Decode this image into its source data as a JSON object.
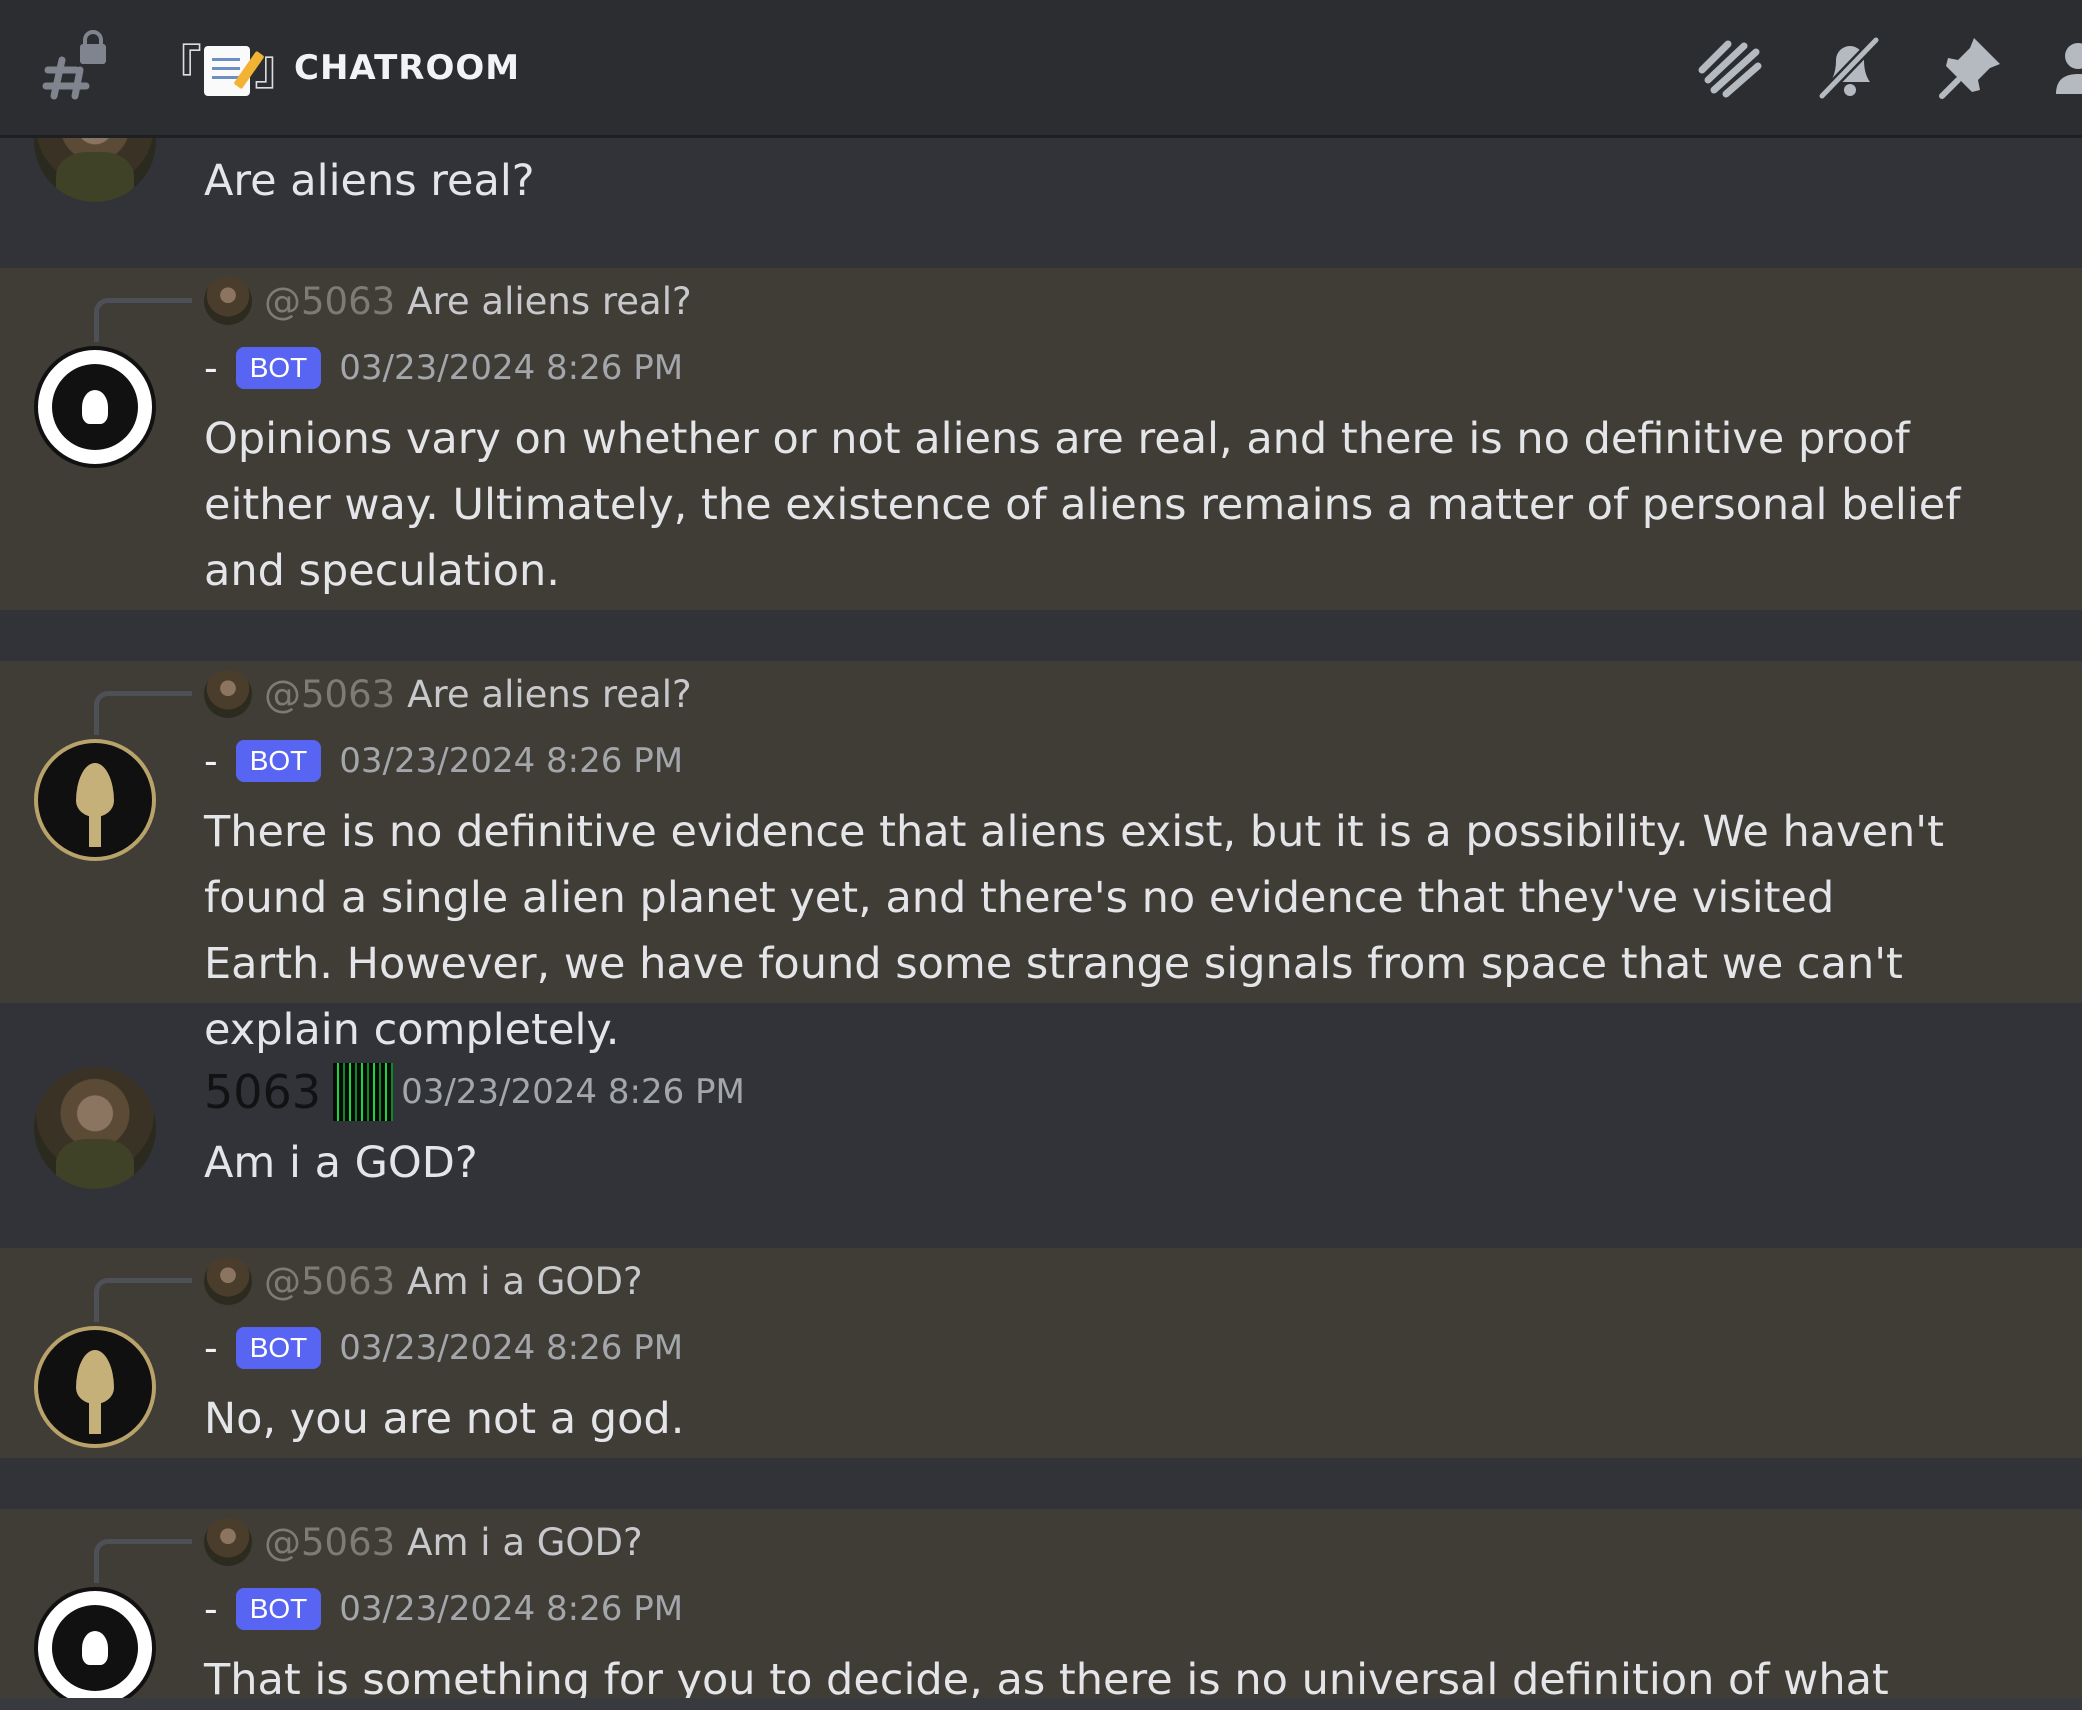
{
  "header": {
    "channel_prefix": "『📝』",
    "channel_name": "CHATROOM"
  },
  "messages": [
    {
      "type": "user",
      "content": "Are aliens real?"
    },
    {
      "type": "bot",
      "reply_mention": "@5063",
      "reply_text": "Are aliens real?",
      "author": "-",
      "badge": "BOT",
      "timestamp": "03/23/2024 8:26 PM",
      "content": "Opinions vary on whether or not aliens are real, and there is no definitive proof either way. Ultimately, the existence of aliens remains a matter of personal belief and speculation."
    },
    {
      "type": "bot",
      "reply_mention": "@5063",
      "reply_text": "Are aliens real?",
      "author": "-",
      "badge": "BOT",
      "timestamp": "03/23/2024 8:26 PM",
      "content": "There is no definitive evidence that aliens exist, but it is a possibility. We haven't found a single alien planet yet, and there's no evidence that they've visited Earth. However, we have found some strange signals from space that we can't explain completely."
    },
    {
      "type": "user",
      "author": "5063",
      "timestamp": "03/23/2024 8:26 PM",
      "content": "Am i a GOD?"
    },
    {
      "type": "bot",
      "reply_mention": "@5063",
      "reply_text": "Am i a GOD?",
      "author": "-",
      "badge": "BOT",
      "timestamp": "03/23/2024 8:26 PM",
      "content": "No, you are not a god."
    },
    {
      "type": "bot",
      "reply_mention": "@5063",
      "reply_text": "Am i a GOD?",
      "author": "-",
      "badge": "BOT",
      "timestamp": "03/23/2024 8:26 PM",
      "content": "That is something for you to decide, as there is no universal definition of what"
    }
  ],
  "icons": {
    "channel": "hash-lock-icon",
    "threads": "threads-icon",
    "notifications": "bell-slash-icon",
    "pinned": "pin-icon",
    "members": "member-list-icon"
  }
}
